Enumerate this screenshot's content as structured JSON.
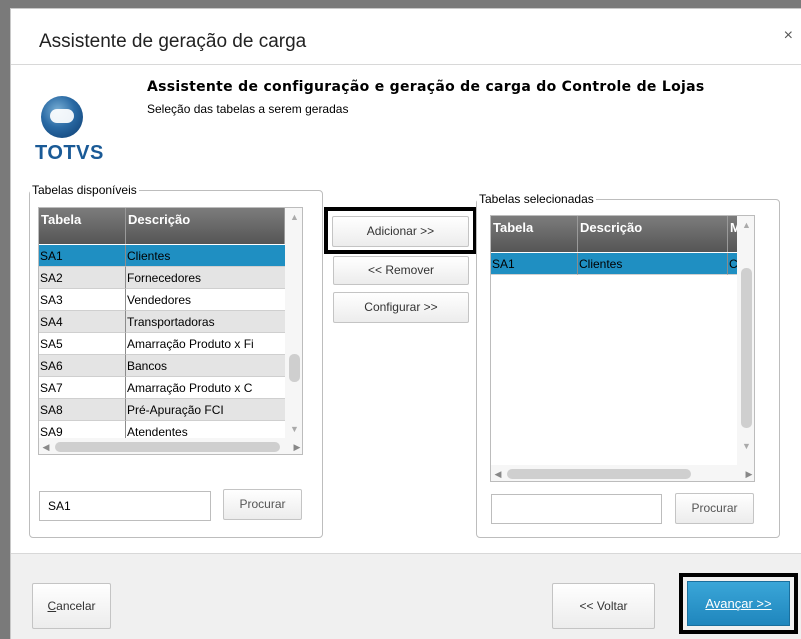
{
  "dialog": {
    "title": "Assistente de geração de carga",
    "close_glyph": "×"
  },
  "header": {
    "logo_text": "TOTVS",
    "title": "Assistente de configuração e geração de carga do Controle de Lojas",
    "subtitle": "Seleção das tabelas a serem geradas"
  },
  "available": {
    "legend": "Tabelas disponíveis",
    "columns": [
      "Tabela",
      "Descrição"
    ],
    "rows": [
      {
        "tabela": "SA1",
        "descricao": "Clientes",
        "selected": true
      },
      {
        "tabela": "SA2",
        "descricao": "Fornecedores"
      },
      {
        "tabela": "SA3",
        "descricao": "Vendedores"
      },
      {
        "tabela": "SA4",
        "descricao": "Transportadoras"
      },
      {
        "tabela": "SA5",
        "descricao": "Amarração Produto x Fi"
      },
      {
        "tabela": "SA6",
        "descricao": "Bancos"
      },
      {
        "tabela": "SA7",
        "descricao": "Amarração Produto x C"
      },
      {
        "tabela": "SA8",
        "descricao": "Pré-Apuração FCI"
      },
      {
        "tabela": "SA9",
        "descricao": "Atendentes"
      }
    ],
    "search_value": "SA1",
    "search_button": "Procurar"
  },
  "actions": {
    "add": "Adicionar >>",
    "remove": "<< Remover",
    "configure": "Configurar >>"
  },
  "selected": {
    "legend": "Tabelas selecionadas",
    "columns": [
      "Tabela",
      "Descrição",
      "M"
    ],
    "rows": [
      {
        "tabela": "SA1",
        "descricao": "Clientes",
        "extra": "C",
        "selected": true
      }
    ],
    "search_value": "",
    "search_button": "Procurar"
  },
  "footer": {
    "cancel": "Cancelar",
    "back": "<< Voltar",
    "next": "Avançar >>"
  },
  "colors": {
    "selection": "#1f8fc2",
    "primary_button": "#1f86bd",
    "grid_header": "#555555"
  }
}
